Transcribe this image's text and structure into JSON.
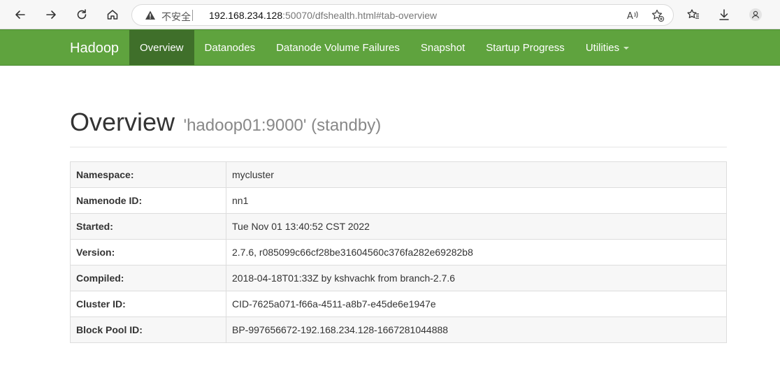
{
  "browser": {
    "security_label": "不安全",
    "url_host": "192.168.234.128",
    "url_rest": ":50070/dfshealth.html#tab-overview"
  },
  "navbar": {
    "brand": "Hadoop",
    "items": [
      {
        "label": "Overview"
      },
      {
        "label": "Datanodes"
      },
      {
        "label": "Datanode Volume Failures"
      },
      {
        "label": "Snapshot"
      },
      {
        "label": "Startup Progress"
      },
      {
        "label": "Utilities"
      }
    ],
    "colors": {
      "bar": "#5fa33e",
      "active": "#3f6f2a"
    }
  },
  "overview": {
    "title": "Overview",
    "subtitle": "'hadoop01:9000' (standby)",
    "rows": [
      {
        "key": "Namespace:",
        "value": "mycluster"
      },
      {
        "key": "Namenode ID:",
        "value": "nn1"
      },
      {
        "key": "Started:",
        "value": "Tue Nov 01 13:40:52 CST 2022"
      },
      {
        "key": "Version:",
        "value": "2.7.6, r085099c66cf28be31604560c376fa282e69282b8"
      },
      {
        "key": "Compiled:",
        "value": "2018-04-18T01:33Z by kshvachk from branch-2.7.6"
      },
      {
        "key": "Cluster ID:",
        "value": "CID-7625a071-f66a-4511-a8b7-e45de6e1947e"
      },
      {
        "key": "Block Pool ID:",
        "value": "BP-997656672-192.168.234.128-1667281044888"
      }
    ]
  }
}
